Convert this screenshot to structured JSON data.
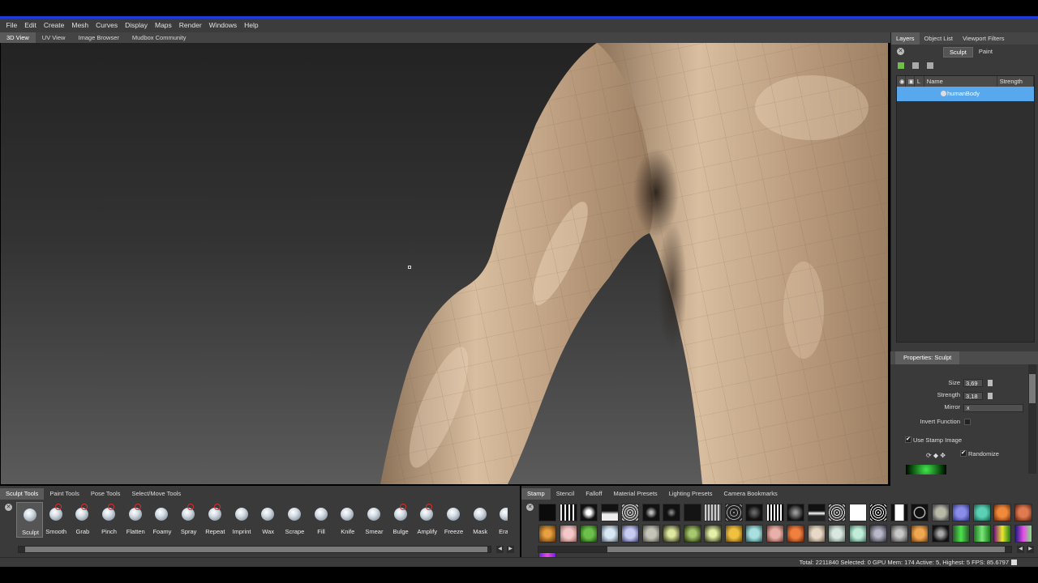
{
  "menu": [
    "File",
    "Edit",
    "Create",
    "Mesh",
    "Curves",
    "Display",
    "Maps",
    "Render",
    "Windows",
    "Help"
  ],
  "view_tabs": [
    "3D View",
    "UV View",
    "Image Browser",
    "Mudbox Community"
  ],
  "right_panel": {
    "tabs": [
      "Layers",
      "Object List",
      "Viewport Filters"
    ],
    "sub_tabs": [
      "Sculpt",
      "Paint"
    ],
    "columns": [
      "Name",
      "Strength"
    ],
    "layer_name": "humanBody"
  },
  "properties": {
    "title": "Properties: Sculpt",
    "size_label": "Size",
    "size_value": "3,69",
    "strength_label": "Strength",
    "strength_value": "3,18",
    "mirror_label": "Mirror",
    "mirror_value": "x",
    "invert_label": "Invert Function",
    "use_stamp_label": "Use Stamp Image",
    "randomize_label": "Randomize"
  },
  "tool_tray": {
    "tabs": [
      "Sculpt Tools",
      "Paint Tools",
      "Pose Tools",
      "Select/Move Tools"
    ],
    "tools": [
      "Sculpt",
      "Smooth",
      "Grab",
      "Pinch",
      "Flatten",
      "Foamy",
      "Spray",
      "Repeat",
      "Imprint",
      "Wax",
      "Scrape",
      "Fill",
      "Knife",
      "Smear",
      "Bulge",
      "Amplify",
      "Freeze",
      "Mask",
      "Erase"
    ]
  },
  "stamp_tray": {
    "tabs": [
      "Stamp",
      "Stencil",
      "Falloff",
      "Material Presets",
      "Lighting Presets",
      "Camera Bookmarks"
    ]
  },
  "status": "Total: 2211840  Selected: 0 GPU Mem: 174  Active: 5, Highest: 5  FPS: 85.6797",
  "colors": {
    "accent_blue": "#1e3ad8",
    "selection": "#58a8ee",
    "skin": "#c9a888"
  }
}
